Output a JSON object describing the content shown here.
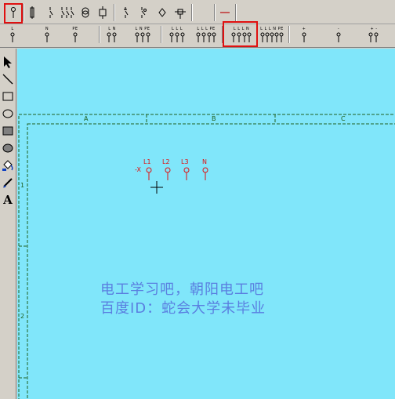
{
  "toolbar_top": {
    "buttons": [
      "terminal-icon",
      "fuse-icon",
      "switch-icon",
      "multi-switch-icon",
      "transformer-icon",
      "meter-icon",
      "breaker-icon",
      "load-switch-icon",
      "contact-icon",
      "junction-icon",
      "dash-icon"
    ]
  },
  "toolbar_terminals": {
    "items": [
      {
        "name": "single",
        "label": "L"
      },
      {
        "name": "n",
        "label": "N"
      },
      {
        "name": "pe",
        "label": "PE"
      },
      {
        "name": "ln",
        "label": "L N"
      },
      {
        "name": "lnpe",
        "label": "L N PE"
      },
      {
        "name": "lll",
        "label": "L L L"
      },
      {
        "name": "lllpe",
        "label": "L L L PE"
      },
      {
        "name": "llln",
        "label": "L L L N"
      },
      {
        "name": "lllnpe",
        "label": "L L L N PE"
      },
      {
        "name": "plus",
        "label": "+"
      },
      {
        "name": "minus",
        "label": "-"
      },
      {
        "name": "plusminus",
        "label": "+ -"
      }
    ]
  },
  "palette": {
    "tools": [
      "pointer-icon",
      "line-icon",
      "rectangle-icon",
      "ellipse-icon",
      "filled-rectangle-icon",
      "filled-ellipse-icon",
      "fill-bucket-icon",
      "pen-icon",
      "text-icon"
    ],
    "text_tool_label": "A"
  },
  "drawing": {
    "columns": [
      "A",
      "B",
      "C"
    ],
    "rows": [
      "1",
      "2"
    ],
    "terminal_prefix": "-X",
    "terminals": [
      "L1",
      "L2",
      "L3",
      "N"
    ],
    "watermark_line1": "电工学习吧，朝阳电工吧",
    "watermark_line2": "百度ID：蛇会大学未毕业"
  },
  "colors": {
    "canvas": "#80e6fa",
    "frame": "#206020",
    "terminal": "#e01010",
    "watermark": "#5a7fe0",
    "highlight": "#e01010"
  }
}
